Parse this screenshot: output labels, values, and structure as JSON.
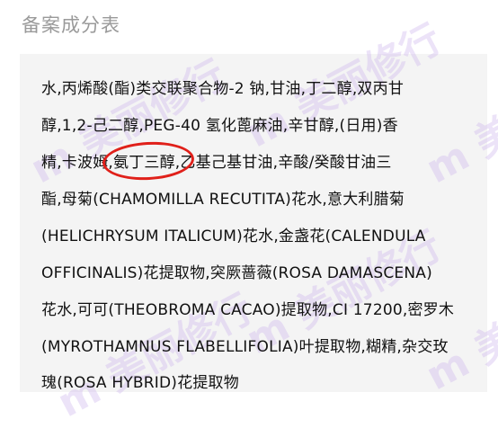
{
  "section": {
    "title": "备案成分表"
  },
  "ingredients": {
    "lines": [
      "水,丙烯酸(酯)类交联聚合物-2 钠,甘油,丁二醇,双丙甘",
      "醇,1,2-己二醇,PEG-40 氢化蓖麻油,辛甘醇,(日用)香",
      "精,卡波姆,氨丁三醇,乙基己基甘油,辛酸/癸酸甘油三",
      "酯,母菊(CHAMOMILLA RECUTITA)花水,意大利腊菊",
      "(HELICHRYSUM ITALICUM)花水,金盏花(CALENDULA",
      "OFFICINALIS)花提取物,突厥蔷薇(ROSA DAMASCENA)",
      "花水,可可(THEOBROMA CACAO)提取物,CI 17200,密罗木",
      "(MYROTHAMNUS FLABELLIFOLIA)叶提取物,糊精,杂交玫",
      "瑰(ROSA HYBRID)花提取物"
    ],
    "highlighted_term": "氨丁三醇"
  },
  "watermark": {
    "text": "m 美丽修行"
  },
  "colors": {
    "title": "#9a9a9a",
    "box_background": "#f4f4f4",
    "highlight": "#e0201a",
    "watermark": "#c8afeb"
  }
}
